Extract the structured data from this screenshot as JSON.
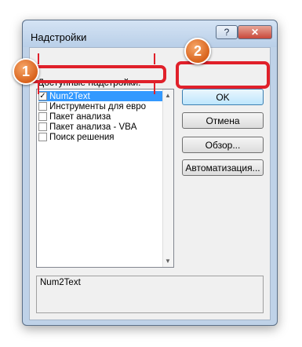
{
  "window": {
    "title": "Надстройки",
    "help_label": "?",
    "close_label": "✕"
  },
  "addins": {
    "label": "Доступные надстройки:",
    "items": [
      {
        "label": "Num2Text",
        "checked": true,
        "selected": true
      },
      {
        "label": "Инструменты для евро",
        "checked": false,
        "selected": false
      },
      {
        "label": "Пакет анализа",
        "checked": false,
        "selected": false
      },
      {
        "label": "Пакет анализа - VBA",
        "checked": false,
        "selected": false
      },
      {
        "label": "Поиск решения",
        "checked": false,
        "selected": false
      }
    ],
    "check_glyph": "✓"
  },
  "buttons": {
    "ok": "OK",
    "cancel": "Отмена",
    "browse": "Обзор...",
    "automation": "Автоматизация..."
  },
  "description": {
    "text": "Num2Text"
  },
  "annotations": {
    "step1": "1",
    "step2": "2",
    "highlight_color": "#e0202a",
    "badge_color": "#d8621c"
  },
  "scrollbar": {
    "up_glyph": "▲",
    "down_glyph": "▼"
  }
}
